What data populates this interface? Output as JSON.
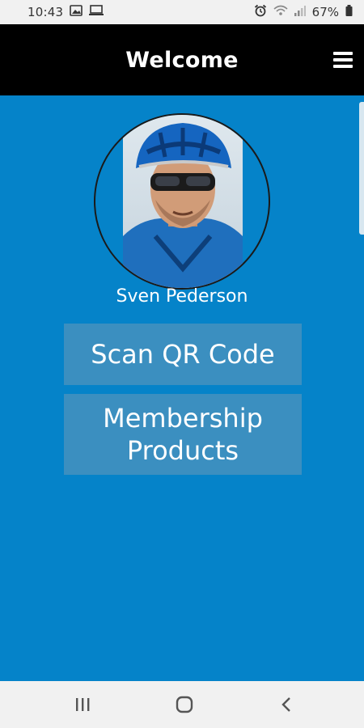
{
  "status_bar": {
    "time": "10:43",
    "battery_percent": "67%",
    "icons": [
      "image-icon",
      "screen-icon",
      "alarm-icon",
      "wifi-icon",
      "signal-icon",
      "battery-icon"
    ]
  },
  "app_bar": {
    "title": "Welcome",
    "menu_icon": "hamburger-menu-icon"
  },
  "profile": {
    "name": "Sven Pederson",
    "avatar": "cyclist-photo"
  },
  "buttons": {
    "scan_label": "Scan QR Code",
    "membership_label": "Membership\nProducts"
  },
  "nav_bar": {
    "recents_icon": "recents-icon",
    "home_icon": "home-icon",
    "back_icon": "back-icon"
  },
  "colors": {
    "content_background": "#0583c9",
    "app_bar_background": "#000000",
    "button_background": "#3b8fc0",
    "system_bar_background": "#f1f1f1"
  }
}
